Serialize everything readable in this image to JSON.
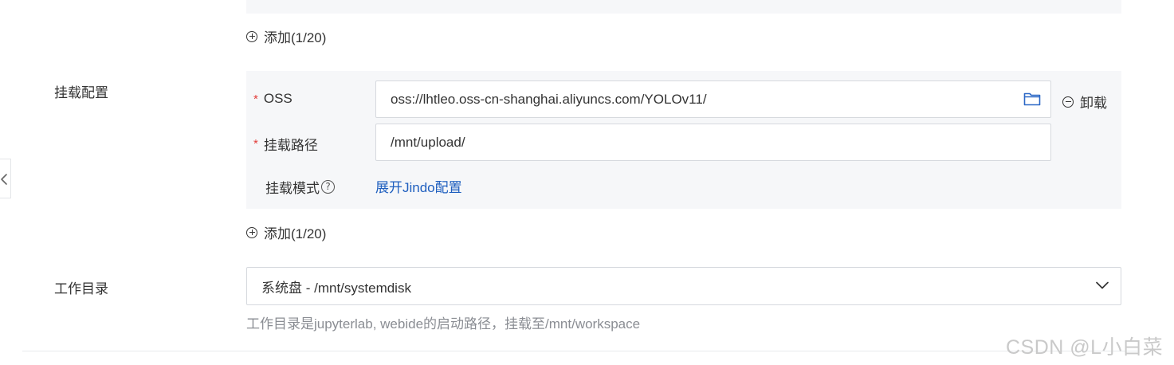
{
  "env_add": {
    "label": "添加(1/20)"
  },
  "mount": {
    "section_label": "挂载配置",
    "oss_label": "OSS",
    "oss_value": "oss://lhtleo.oss-cn-shanghai.aliyuncs.com/YOLOv11/",
    "path_label": "挂载路径",
    "path_value": "/mnt/upload/",
    "mode_label": "挂载模式",
    "mode_help": "?",
    "jindo_link": "展开Jindo配置",
    "unmount_label": "卸载",
    "required_mark": "*",
    "add_label": "添加(1/20)"
  },
  "workdir": {
    "section_label": "工作目录",
    "selected": "系统盘 - /mnt/systemdisk",
    "hint": "工作目录是jupyterlab, webide的启动路径，挂载至/mnt/workspace"
  },
  "watermark": "CSDN @L小白菜",
  "icons": {
    "add": "plus-circle-icon",
    "remove": "minus-circle-icon",
    "folder": "folder-icon",
    "help": "question-circle-icon",
    "dropdown": "chevron-down-icon",
    "collapse": "chevron-left-icon"
  },
  "colors": {
    "link": "#1f5fbf",
    "required": "#e23c39",
    "panel_bg": "#f6f7f9",
    "hint": "#8a8d93"
  }
}
